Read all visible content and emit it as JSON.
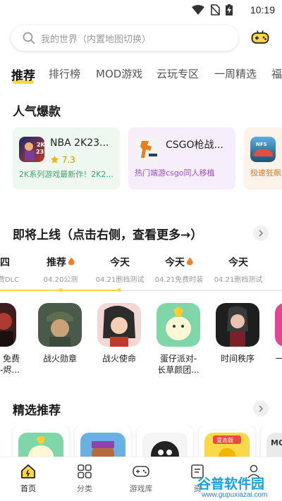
{
  "status_bar": {
    "time": "10:19"
  },
  "search": {
    "placeholder": "我的世界（内置地图切换）"
  },
  "tabs": [
    {
      "label": "推荐",
      "active": true
    },
    {
      "label": "排行榜"
    },
    {
      "label": "MOD游戏"
    },
    {
      "label": "云玩专区"
    },
    {
      "label": "一周精选"
    },
    {
      "label": "福"
    }
  ],
  "hot_section": {
    "title": "人气爆款",
    "cards": [
      {
        "name": "NBA 2K23...",
        "rating": "7.3",
        "desc": "2K系列游戏最新作！2K2...",
        "bg": "#eef8f1",
        "desc_color": "#3aa66a"
      },
      {
        "name": "CSGO枪战...",
        "desc": "热门端游csgo同人移植",
        "bg": "#f6eefb",
        "desc_color": "#9b4fc4"
      },
      {
        "name": "",
        "desc": "极速狂飙",
        "bg": "#fdf3ea",
        "desc_color": "#d97a2f"
      }
    ]
  },
  "upcoming_section": {
    "title": "即将上线（点击右侧，查看更多→）",
    "timeline": [
      {
        "label": "四",
        "sub": "免费DLC"
      },
      {
        "label": "推荐",
        "hot": true,
        "sub": "04.20公测"
      },
      {
        "label": "今天",
        "sub": "04.21删档测试"
      },
      {
        "label": "今天",
        "hot": true,
        "sub": "04.21免费时装"
      },
      {
        "label": "今天",
        "sub": "04.21删档测试"
      }
    ],
    "games": [
      {
        "name": "免费\n-烬..."
      },
      {
        "name": "战火勋章"
      },
      {
        "name": "战火使命"
      },
      {
        "name": "蛋仔派对-\n长草颜团..."
      },
      {
        "name": "时间秩序"
      },
      {
        "name": "一"
      }
    ]
  },
  "featured_section": {
    "title": "精选推荐",
    "badge_text": "变态版",
    "badge_text_2": "MO"
  },
  "bottom_nav": [
    {
      "label": "首页",
      "icon": "home-icon",
      "active": true
    },
    {
      "label": "分类",
      "icon": "grid-icon"
    },
    {
      "label": "游戏库",
      "icon": "gamepad-icon"
    },
    {
      "label": "资",
      "icon": "news-icon"
    },
    {
      "label": "",
      "icon": "profile-icon"
    }
  ],
  "watermark": {
    "title": "谷普软件园",
    "url": "www.gupuxiazai.com"
  },
  "colors": {
    "accent": "#ffd54a",
    "hot_flame": "#ff7a1a",
    "rating_star": "#f5b400"
  }
}
